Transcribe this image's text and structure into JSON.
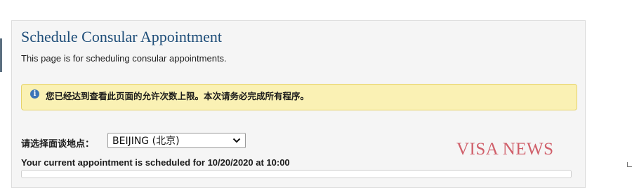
{
  "page": {
    "title": "Schedule Consular Appointment",
    "description": "This page is for scheduling consular appointments."
  },
  "alert": {
    "icon": "info-icon",
    "message": "您已经达到查看此页面的允许次数上限。本次请务必完成所有程序。"
  },
  "location": {
    "label": "请选择面谈地点：",
    "selected": "BEIJING (北京)"
  },
  "appointment": {
    "current_text": "Your current appointment is scheduled for 10/20/2020 at 10:00"
  },
  "watermark": "VISA NEWS",
  "colors": {
    "title": "#1f4e79",
    "alert_bg": "#faf1b4",
    "alert_border": "#e6d36b",
    "info_icon": "#3b74b8",
    "watermark": "#d05f6a"
  }
}
